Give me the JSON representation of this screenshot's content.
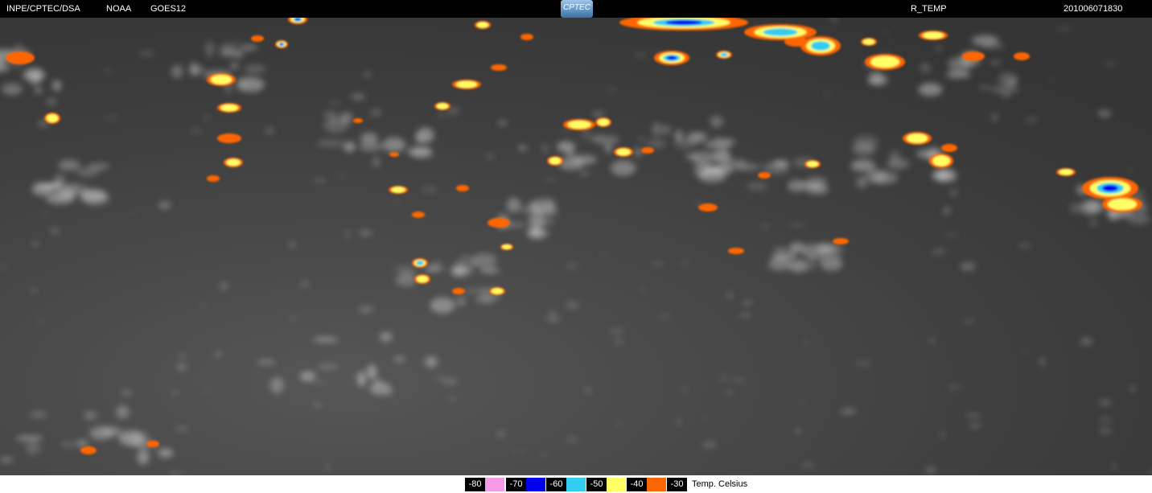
{
  "header": {
    "source": "INPE/CPTEC/DSA",
    "agency": "NOAA",
    "satellite": "GOES12",
    "product": "R_TEMP",
    "timestamp": "201006071830",
    "logo_text": "CPTEC"
  },
  "legend": {
    "unit": "Temp. Celsius",
    "entries": [
      {
        "label": "-80",
        "color": "#f59be6"
      },
      {
        "label": "-70",
        "color": "#0000ee"
      },
      {
        "label": "-60",
        "color": "#33ccf2"
      },
      {
        "label": "-50",
        "color": "#ffff66"
      },
      {
        "label": "-40",
        "color": "#ff6600"
      },
      {
        "label": "-30",
        "color": "#ff6600"
      }
    ]
  },
  "colors": {
    "background": "#3c3c3c",
    "cloud": "#c8c8c8",
    "cold_orange": "#ff6600",
    "cold_yellow": "#ffff66",
    "cold_cyan": "#33ccf2",
    "cold_blue": "#0000ee"
  }
}
